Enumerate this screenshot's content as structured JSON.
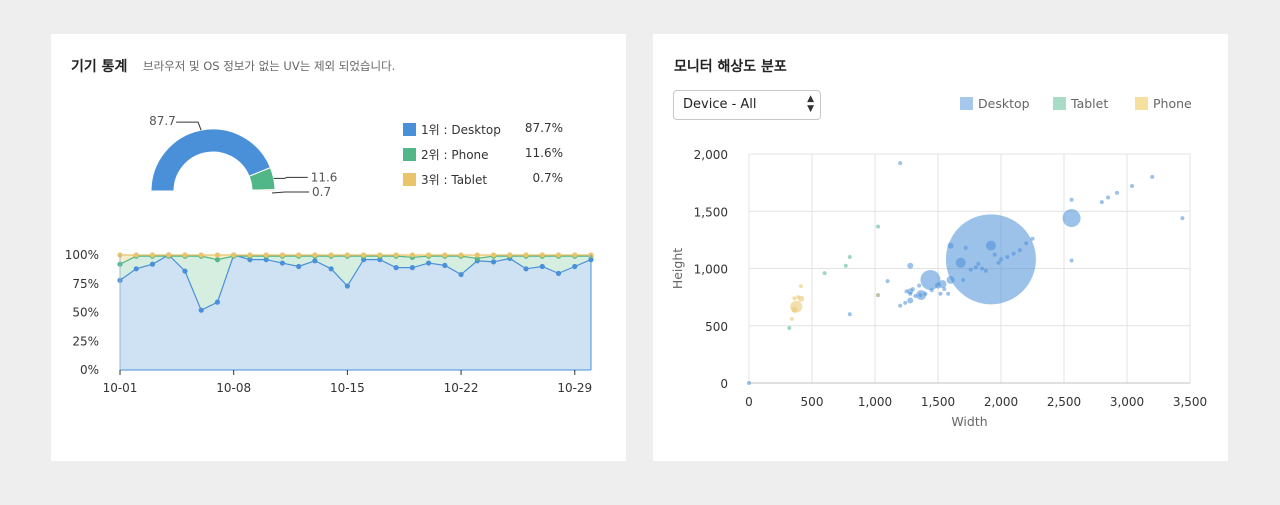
{
  "device_stats": {
    "title": "기기 통계",
    "subtitle": "브라우저 및 OS 정보가 없는 UV는 제외 되었습니다.",
    "legend": [
      {
        "label": "1위 : Desktop",
        "value": "87.7%",
        "color": "#4a90d9"
      },
      {
        "label": "2위 : Phone",
        "value": "11.6%",
        "color": "#52b788"
      },
      {
        "label": "3위 : Tablet",
        "value": "0.7%",
        "color": "#e9c46a"
      }
    ]
  },
  "monitor": {
    "title": "모니터 해상도 분포",
    "select_value": "Device - All",
    "legend": [
      {
        "label": "Desktop",
        "color": "#a5c8ec"
      },
      {
        "label": "Tablet",
        "color": "#a8dcc6"
      },
      {
        "label": "Phone",
        "color": "#f6e0a0"
      }
    ]
  },
  "chart_data": [
    {
      "type": "pie",
      "variant": "semi-donut",
      "slices": [
        {
          "name": "Desktop",
          "value": 87.7,
          "label": "87.7",
          "color": "#4a90d9"
        },
        {
          "name": "Phone",
          "value": 11.6,
          "label": "11.6",
          "color": "#52b788"
        },
        {
          "name": "Tablet",
          "value": 0.7,
          "label": "0.7",
          "color": "#e9c46a"
        }
      ]
    },
    {
      "type": "area",
      "stacked": true,
      "ylim": [
        0,
        100
      ],
      "yticks": [
        "0%",
        "25%",
        "50%",
        "75%",
        "100%"
      ],
      "xticks": [
        "10-01",
        "10-08",
        "10-15",
        "10-22",
        "10-29"
      ],
      "x": [
        "10-01",
        "10-02",
        "10-03",
        "10-04",
        "10-05",
        "10-06",
        "10-07",
        "10-08",
        "10-09",
        "10-10",
        "10-11",
        "10-12",
        "10-13",
        "10-14",
        "10-15",
        "10-16",
        "10-17",
        "10-18",
        "10-19",
        "10-20",
        "10-21",
        "10-22",
        "10-23",
        "10-24",
        "10-25",
        "10-26",
        "10-27",
        "10-28",
        "10-29",
        "10-30"
      ],
      "series": [
        {
          "color": "#4a90d9",
          "values": [
            78,
            88,
            92,
            100,
            86,
            52,
            59,
            100,
            96,
            96,
            93,
            90,
            95,
            88,
            73,
            96,
            96,
            89,
            89,
            93,
            91,
            83,
            95,
            94,
            97,
            88,
            90,
            84,
            90,
            96
          ]
        },
        {
          "color": "#52b788",
          "values": [
            92,
            99,
            99,
            99,
            99,
            99,
            96,
            99,
            99,
            99,
            99,
            99,
            99,
            99,
            99,
            99,
            99,
            99,
            98,
            99,
            99,
            99,
            97,
            99,
            99,
            99,
            99,
            99,
            99,
            99
          ]
        },
        {
          "color": "#e9c46a",
          "values": [
            100,
            100,
            100,
            100,
            100,
            100,
            100,
            100,
            100,
            100,
            100,
            100,
            100,
            100,
            100,
            100,
            100,
            100,
            100,
            100,
            100,
            100,
            100,
            100,
            100,
            100,
            100,
            100,
            100,
            100
          ]
        }
      ]
    },
    {
      "type": "scatter",
      "variant": "bubble",
      "xlabel": "Width",
      "ylabel": "Height",
      "xlim": [
        0,
        3500
      ],
      "ylim": [
        0,
        2000
      ],
      "xticks": [
        "0",
        "500",
        "1,000",
        "1,500",
        "2,000",
        "2,500",
        "3,000",
        "3,500"
      ],
      "yticks": [
        "0",
        "500",
        "1,000",
        "1,500",
        "2,000"
      ],
      "series": [
        {
          "name": "Desktop",
          "color": "#4a90d9",
          "points": [
            [
              1920,
              1080,
              45
            ],
            [
              1366,
              768,
              5
            ],
            [
              1440,
              900,
              10
            ],
            [
              1536,
              864,
              4
            ],
            [
              1600,
              900,
              4
            ],
            [
              1680,
              1050,
              5
            ],
            [
              1280,
              1024,
              3
            ],
            [
              1280,
              800,
              3
            ],
            [
              1280,
              720,
              3
            ],
            [
              2560,
              1440,
              9
            ],
            [
              1920,
              1200,
              5
            ],
            [
              1600,
              1200,
              3
            ],
            [
              1200,
              1920,
              2
            ],
            [
              1024,
              768,
              2
            ],
            [
              800,
              600,
              2
            ],
            [
              1360,
              768,
              2
            ],
            [
              1250,
              800,
              2
            ],
            [
              1300,
              820,
              2
            ],
            [
              1200,
              675,
              2
            ],
            [
              1240,
              700,
              2
            ],
            [
              1100,
              890,
              2
            ],
            [
              1350,
              850,
              2
            ],
            [
              1500,
              850,
              3
            ],
            [
              1550,
              820,
              2
            ],
            [
              1580,
              780,
              2
            ],
            [
              1520,
              780,
              2
            ],
            [
              1450,
              810,
              2
            ],
            [
              1400,
              780,
              2
            ],
            [
              1280,
              780,
              2
            ],
            [
              1320,
              760,
              2
            ],
            [
              1760,
              990,
              2
            ],
            [
              1800,
              1010,
              2
            ],
            [
              1850,
              1000,
              2
            ],
            [
              1880,
              980,
              2
            ],
            [
              1980,
              1050,
              2
            ],
            [
              2050,
              1100,
              2
            ],
            [
              2100,
              1130,
              2
            ],
            [
              2150,
              1160,
              2
            ],
            [
              2200,
              1220,
              2
            ],
            [
              2250,
              1260,
              2
            ],
            [
              2560,
              1600,
              2
            ],
            [
              2560,
              1070,
              2
            ],
            [
              2800,
              1580,
              2
            ],
            [
              2850,
              1620,
              2
            ],
            [
              2920,
              1660,
              2
            ],
            [
              3040,
              1720,
              2
            ],
            [
              3200,
              1800,
              2
            ],
            [
              3440,
              1440,
              2
            ],
            [
              2000,
              1080,
              2
            ],
            [
              1720,
              1180,
              2
            ],
            [
              1700,
              900,
              2
            ],
            [
              1820,
              1040,
              2
            ],
            [
              1950,
              1120,
              2
            ],
            [
              0,
              0,
              2
            ]
          ]
        },
        {
          "name": "Tablet",
          "color": "#52b788",
          "points": [
            [
              1024,
              1366,
              2
            ],
            [
              800,
              1100,
              2
            ],
            [
              600,
              960,
              2
            ],
            [
              768,
              1024,
              2
            ],
            [
              320,
              480,
              2
            ]
          ]
        },
        {
          "name": "Phone",
          "color": "#e9c46a",
          "points": [
            [
              375,
              667,
              6
            ],
            [
              414,
              736,
              3
            ],
            [
              360,
              740,
              2
            ],
            [
              412,
              846,
              2
            ],
            [
              390,
              750,
              2
            ],
            [
              360,
              640,
              3
            ],
            [
              340,
              560,
              2
            ],
            [
              1024,
              768,
              2
            ]
          ]
        }
      ]
    }
  ]
}
